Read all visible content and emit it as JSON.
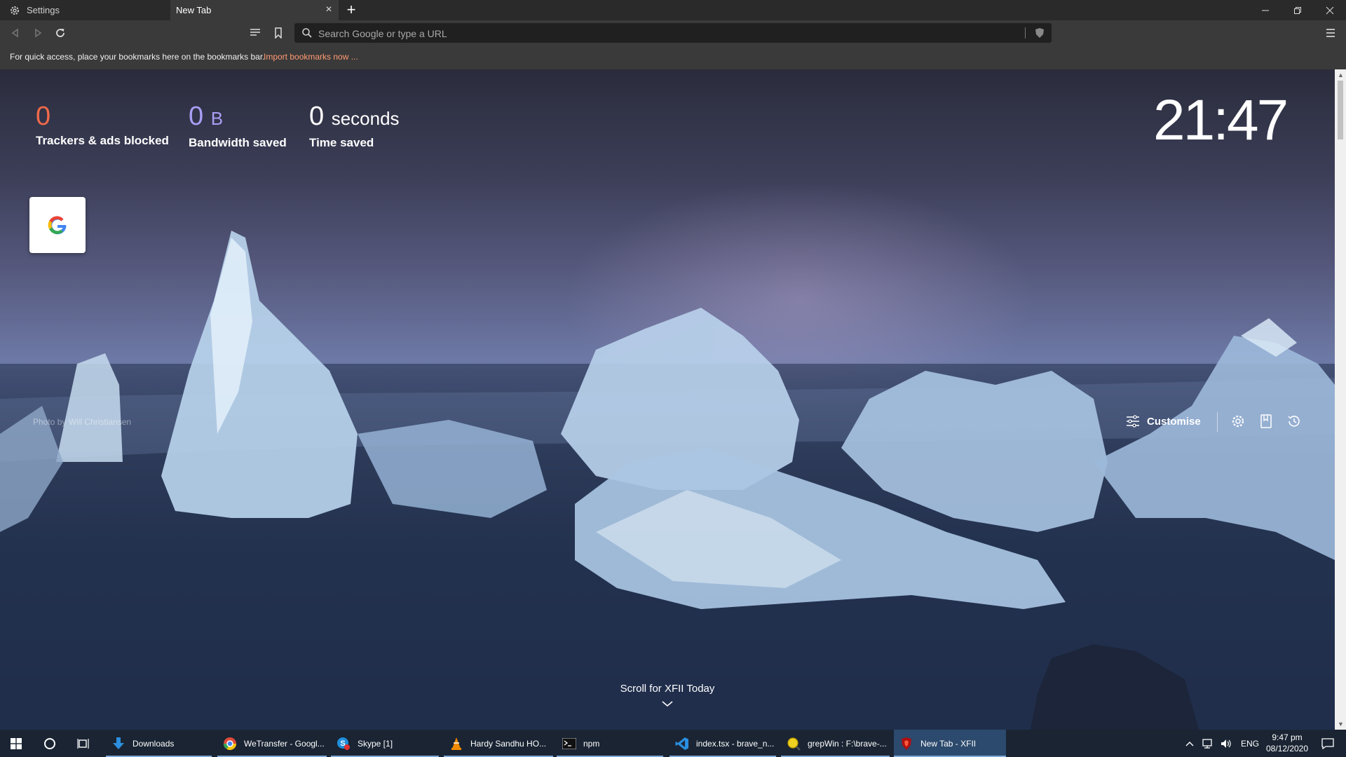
{
  "tabs": [
    {
      "label": "Settings",
      "icon": "gear-icon"
    },
    {
      "label": "New Tab",
      "active": true
    }
  ],
  "window_controls": [
    "minimize",
    "restore",
    "close"
  ],
  "toolbar": {
    "search_placeholder": "Search Google or type a URL"
  },
  "bookmarks_bar": {
    "message": "For quick access, place your bookmarks here on the bookmarks bar.",
    "import_link": "Import bookmarks now ..."
  },
  "stats": [
    {
      "value": "0",
      "unit": "",
      "label": "Trackers & ads blocked",
      "color": "#f06a4a"
    },
    {
      "value": "0",
      "unit": "B",
      "label": "Bandwidth saved",
      "color": "#a99ef5"
    },
    {
      "value": "0",
      "unit": "seconds",
      "label": "Time saved",
      "color": "#ffffff"
    }
  ],
  "clock": "21:47",
  "top_sites": [
    {
      "name": "Google",
      "icon": "google-icon"
    }
  ],
  "photo_credit": "Photo by Will Christiansen",
  "controls": {
    "customise_label": "Customise",
    "icons": [
      "settings-icon",
      "bookmarks-icon",
      "history-icon"
    ]
  },
  "scroll_hint": "Scroll for XFII Today",
  "taskbar": {
    "items": [
      {
        "label": "Downloads",
        "icon": "download-arrow-icon",
        "color": "#2d8fe0"
      },
      {
        "label": "WeTransfer - Googl...",
        "icon": "chrome-icon",
        "color": "#e04a3a"
      },
      {
        "label": "Skype [1]",
        "icon": "skype-icon",
        "color": "#1f8fdc"
      },
      {
        "label": "Hardy Sandhu  HO...",
        "icon": "vlc-icon",
        "color": "#f08a00"
      },
      {
        "label": "npm",
        "icon": "terminal-icon",
        "color": "#111111"
      },
      {
        "label": "index.tsx - brave_n...",
        "icon": "vscode-icon",
        "color": "#2a8fe0"
      },
      {
        "label": "grepWin : F:\\brave-...",
        "icon": "grepwin-icon",
        "color": "#f0d020"
      },
      {
        "label": "New Tab - XFII",
        "icon": "brave-icon",
        "color": "#b01010",
        "active": true
      }
    ],
    "tray": {
      "language": "ENG",
      "time": "9:47 pm",
      "date": "08/12/2020"
    }
  }
}
